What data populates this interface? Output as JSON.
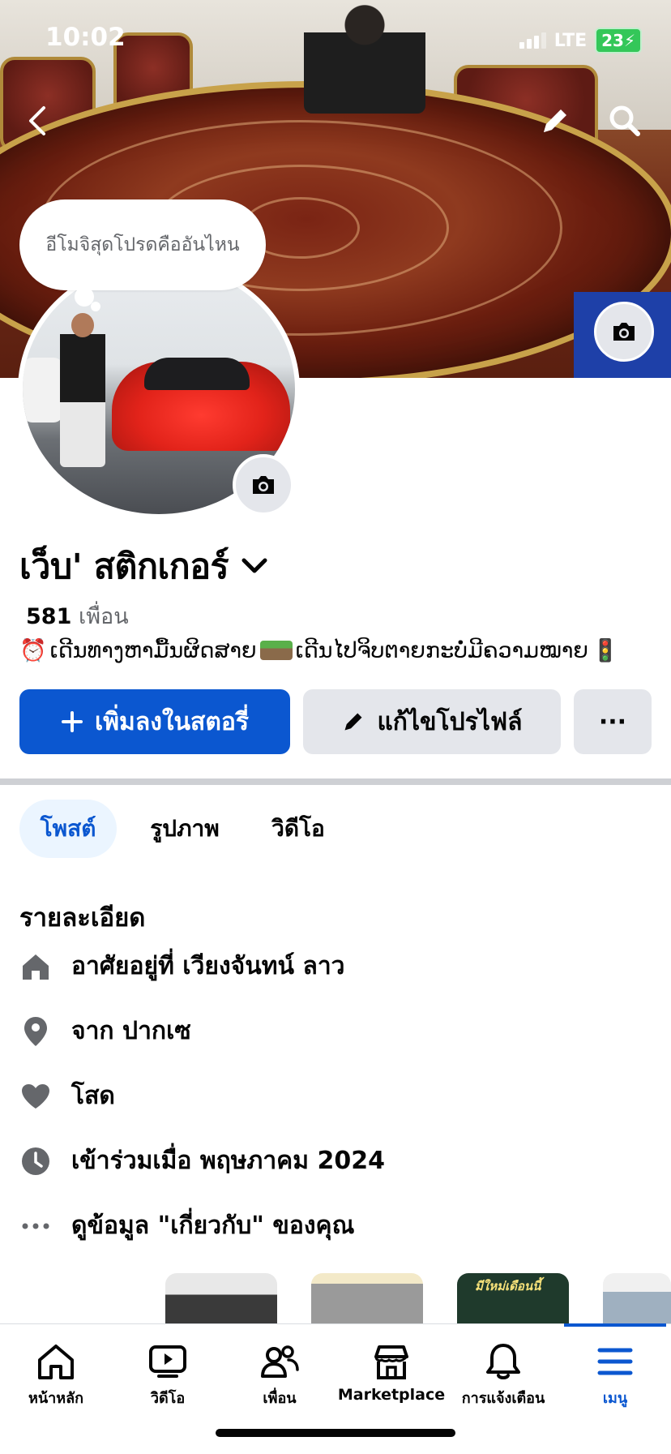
{
  "status_bar": {
    "time": "10:02",
    "network": "LTE",
    "battery": "23"
  },
  "cover": {
    "note_text": "อีโมจิสุดโปรดคืออันไหน"
  },
  "profile": {
    "name": "เว็บ' สติกเกอร์",
    "friends_count": "581",
    "friends_label": "เพื่อน",
    "bio_part1": "ເດີນທາງຫາມື້ນຜິດສາຍ",
    "bio_part2": "ເດີນໄປຈິບຕາຍກະບໍ່ມີຄວາມໝາຍ"
  },
  "actions": {
    "add_story": "เพิ่มลงในสตอรี่",
    "edit_profile": "แก้ไขโปรไฟล์",
    "more": "···"
  },
  "tabs": [
    {
      "label": "โพสต์",
      "active": true
    },
    {
      "label": "รูปภาพ",
      "active": false
    },
    {
      "label": "วิดีโอ",
      "active": false
    }
  ],
  "details": {
    "title": "รายละเอียด",
    "items": [
      {
        "icon": "home-icon",
        "text": "อาศัยอยู่ที่ เวียงจันทน์ ลาว"
      },
      {
        "icon": "location-pin-icon",
        "text": "จาก ปากเซ"
      },
      {
        "icon": "heart-icon",
        "text": "โสด"
      },
      {
        "icon": "clock-icon",
        "text": "เข้าร่วมเมื่อ พฤษภาคม 2024"
      },
      {
        "icon": "more-dots-icon",
        "text": "ดูข้อมูล \"เกี่ยวกับ\" ของคุณ"
      }
    ]
  },
  "thumbnails": {
    "thumb3_text": "มีใหม่เดือนนี้"
  },
  "bottom_nav": [
    {
      "icon": "home-icon",
      "label": "หน้าหลัก"
    },
    {
      "icon": "video-icon",
      "label": "วิดีโอ"
    },
    {
      "icon": "friends-icon",
      "label": "เพื่อน"
    },
    {
      "icon": "marketplace-icon",
      "label": "Marketplace"
    },
    {
      "icon": "bell-icon",
      "label": "การแจ้งเตือน"
    },
    {
      "icon": "menu-icon",
      "label": "เมนู",
      "active": true
    }
  ],
  "colors": {
    "accent": "#0b57d0",
    "button_gray": "#e4e6eb",
    "text": "#050505",
    "secondary_text": "#65676b"
  }
}
